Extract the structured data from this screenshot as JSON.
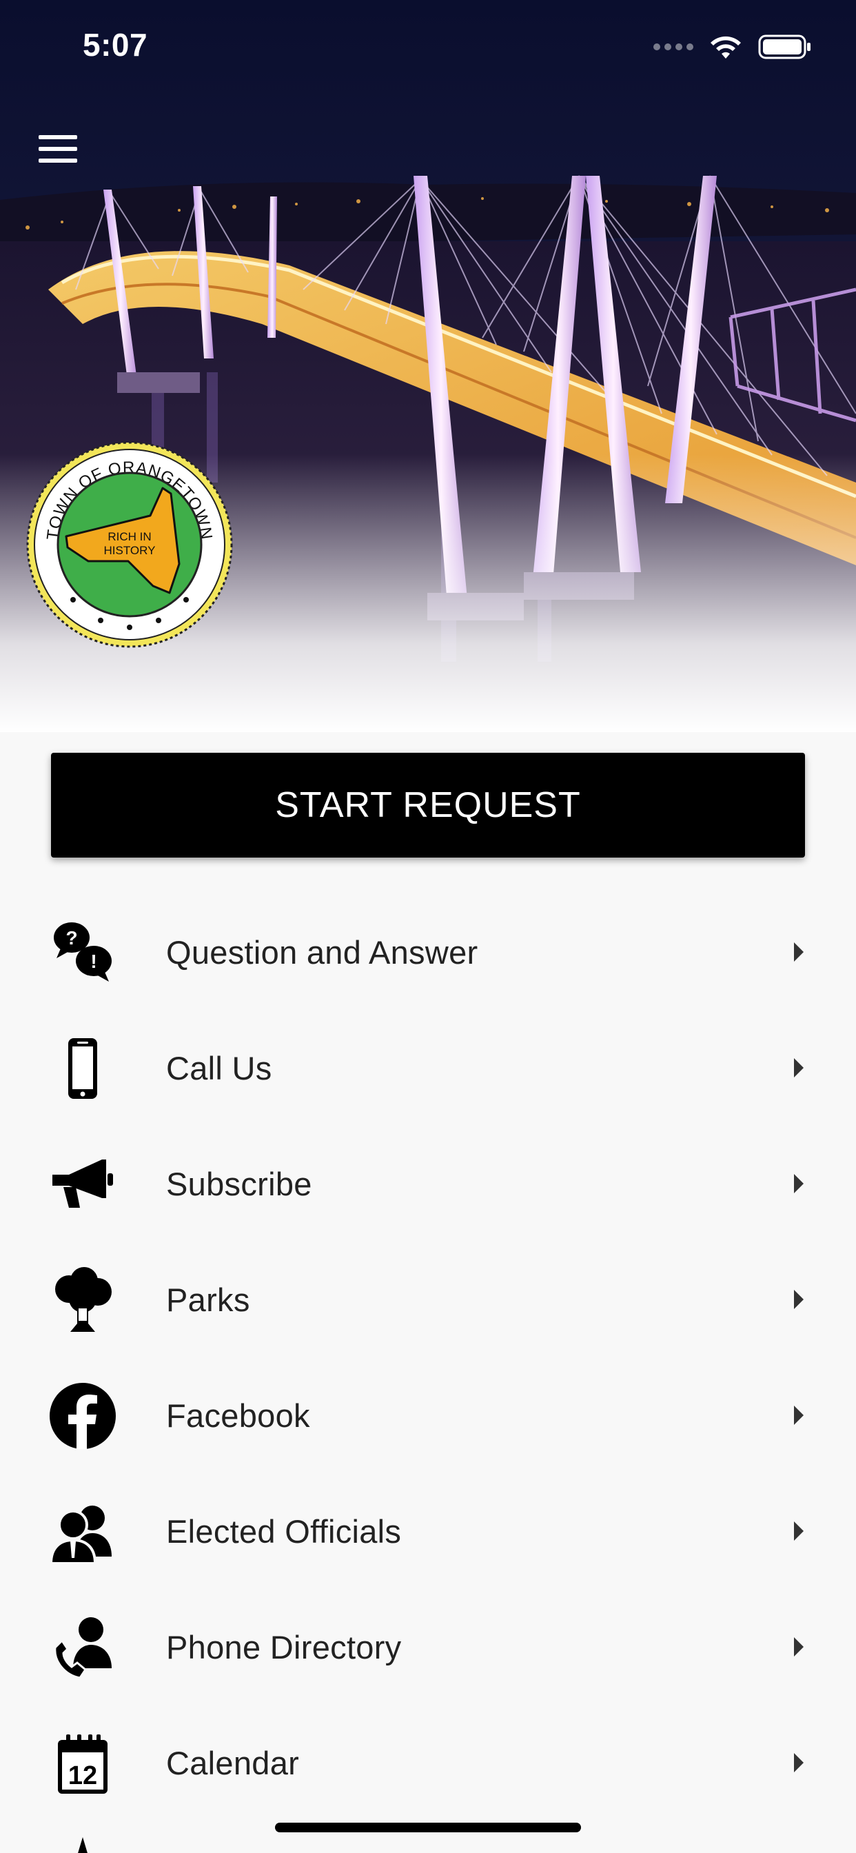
{
  "status_bar": {
    "time": "5:07",
    "icons": [
      "cellular-signal-icon",
      "wifi-icon",
      "battery-icon"
    ]
  },
  "header": {
    "menu_icon": "hamburger-menu-icon",
    "seal": {
      "ring_text": "TOWN OF ORANGETOWN",
      "center_text_line1": "RICH IN",
      "center_text_line2": "HISTORY"
    }
  },
  "actions": {
    "start_request_label": "START REQUEST"
  },
  "menu": {
    "items": [
      {
        "label": "Question and Answer",
        "icon": "question-answer-icon"
      },
      {
        "label": "Call Us",
        "icon": "smartphone-icon"
      },
      {
        "label": "Subscribe",
        "icon": "megaphone-icon"
      },
      {
        "label": "Parks",
        "icon": "tree-icon"
      },
      {
        "label": "Facebook",
        "icon": "facebook-icon"
      },
      {
        "label": "Elected Officials",
        "icon": "officials-icon"
      },
      {
        "label": "Phone Directory",
        "icon": "phone-contact-icon"
      },
      {
        "label": "Calendar",
        "icon": "calendar-icon",
        "calendar_day": "12"
      }
    ]
  },
  "colors": {
    "button_bg": "#000000",
    "button_text": "#ffffff",
    "list_bg": "#f8f8f8",
    "seal_green": "#3fae49",
    "seal_gold": "#f2a81d",
    "sky": "#0b1032"
  }
}
